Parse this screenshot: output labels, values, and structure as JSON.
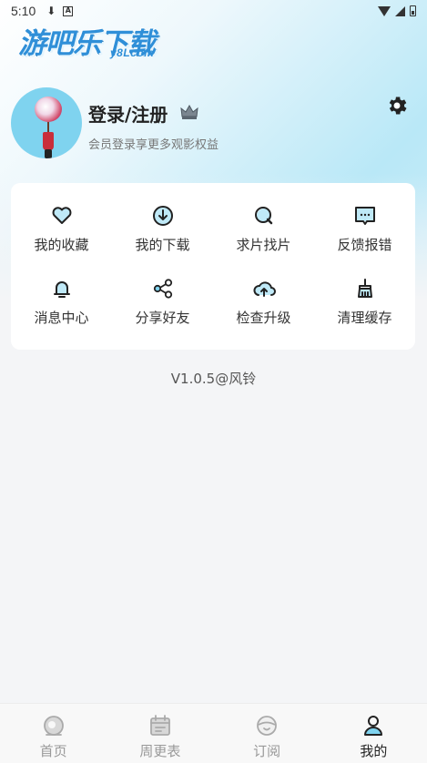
{
  "status_bar": {
    "time": "5:10",
    "download_glyph": "⬇",
    "a_glyph": "A",
    "icons": [
      "download-icon",
      "a-notification-icon",
      "wifi-icon",
      "signal-icon",
      "battery-icon"
    ]
  },
  "brand": {
    "name": "游吧乐下载",
    "sub": "y8Lcom"
  },
  "profile": {
    "title": "登录/注册",
    "subtitle": "会员登录享更多观影权益",
    "icons": [
      "avatar-lantern",
      "crown-icon",
      "settings-gear-icon"
    ]
  },
  "menu": {
    "items": [
      {
        "label": "我的收藏",
        "icon": "heart-icon"
      },
      {
        "label": "我的下载",
        "icon": "download-circle-icon"
      },
      {
        "label": "求片找片",
        "icon": "search-film-icon"
      },
      {
        "label": "反馈报错",
        "icon": "feedback-chat-icon"
      },
      {
        "label": "消息中心",
        "icon": "bell-icon"
      },
      {
        "label": "分享好友",
        "icon": "share-icon"
      },
      {
        "label": "检查升级",
        "icon": "cloud-upload-icon"
      },
      {
        "label": "清理缓存",
        "icon": "broom-icon"
      }
    ]
  },
  "version": "V1.0.5@风铃",
  "bottom_nav": {
    "items": [
      {
        "label": "首页",
        "icon": "home-icon"
      },
      {
        "label": "周更表",
        "icon": "calendar-icon"
      },
      {
        "label": "订阅",
        "icon": "subscribe-icon"
      },
      {
        "label": "我的",
        "icon": "profile-icon"
      }
    ],
    "active_index": 3
  },
  "colors": {
    "accent": "#7fd3ef",
    "brand_blue": "#2f8fd8",
    "background": "#f4f5f7",
    "card": "#ffffff",
    "active_nav": "#222222",
    "inactive_nav": "#999999"
  }
}
